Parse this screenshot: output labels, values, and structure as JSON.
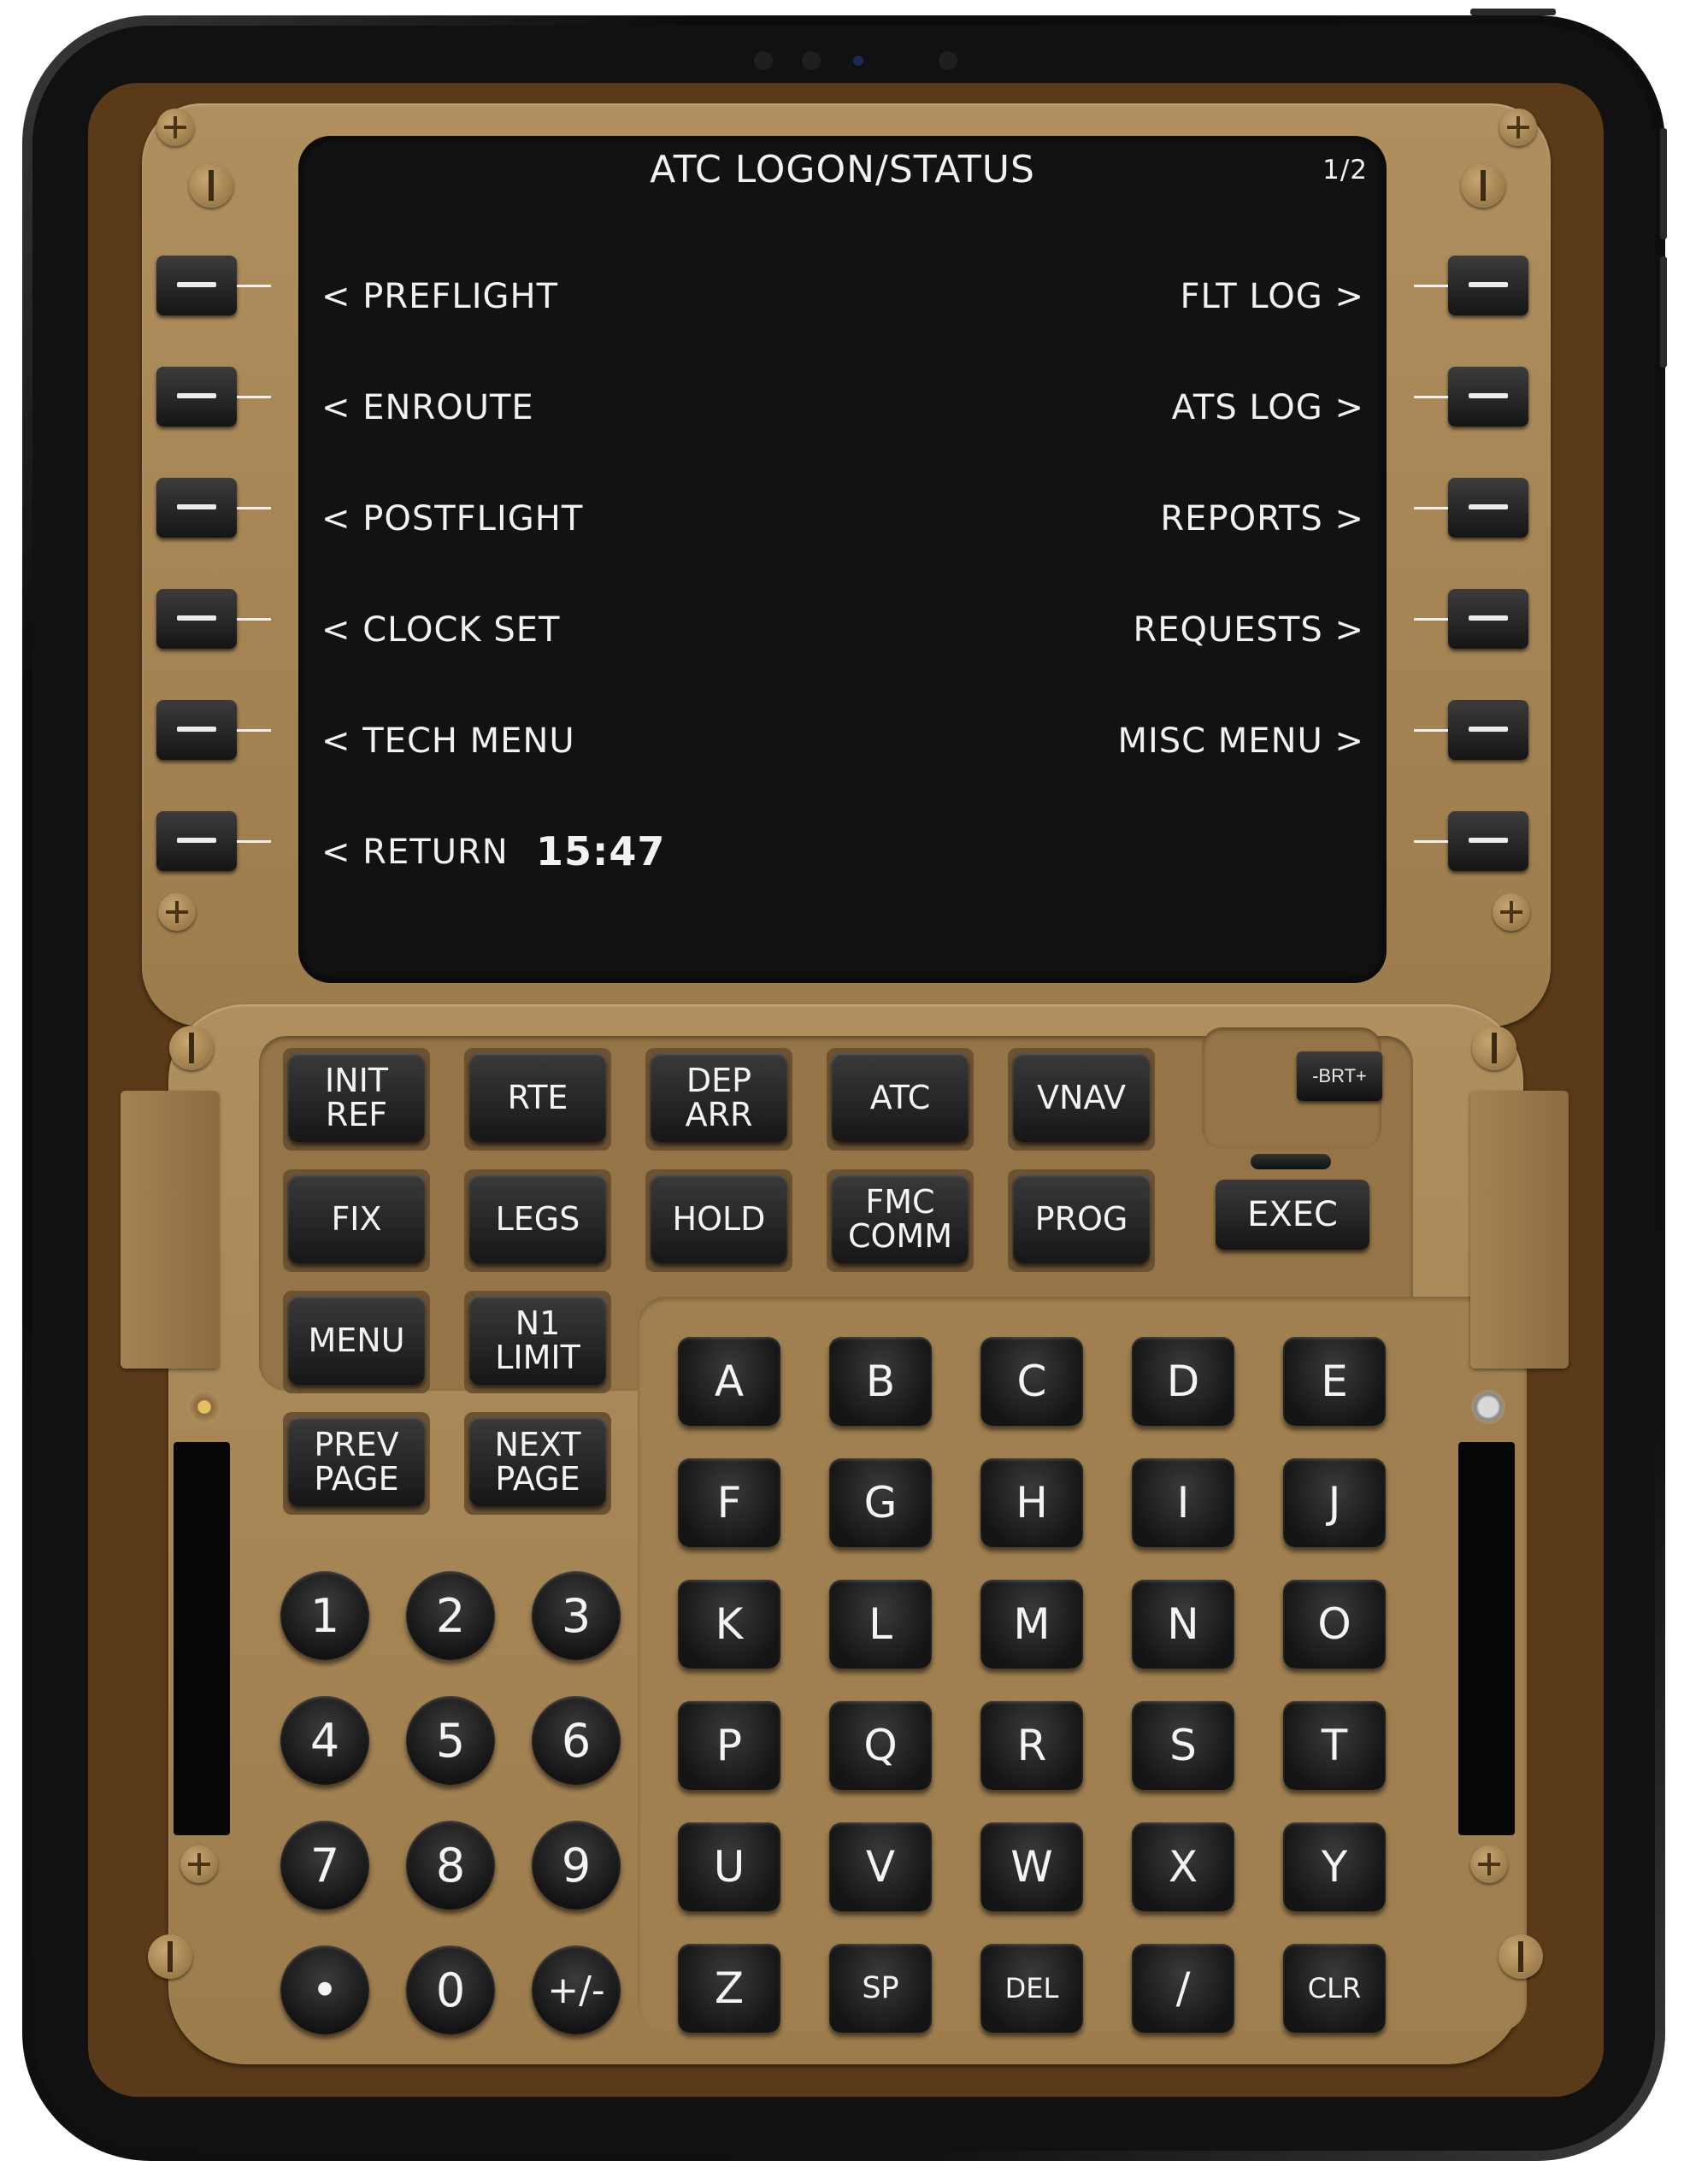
{
  "screen": {
    "title": "ATC LOGON/STATUS",
    "page": "1/2",
    "left_items": [
      "< PREFLIGHT",
      "< ENROUTE",
      "< POSTFLIGHT",
      "< CLOCK SET",
      "< TECH MENU",
      "< RETURN"
    ],
    "right_items": [
      "FLT LOG >",
      "ATS LOG >",
      "REPORTS >",
      "REQUESTS >",
      "MISC MENU >",
      ""
    ],
    "clock": "15:47"
  },
  "function_keys": {
    "init_ref": "INIT\nREF",
    "rte": "RTE",
    "dep_arr": "DEP\nARR",
    "atc": "ATC",
    "vnav": "VNAV",
    "fix": "FIX",
    "legs": "LEGS",
    "hold": "HOLD",
    "fmc_comm": "FMC\nCOMM",
    "prog": "PROG",
    "menu": "MENU",
    "n1_limit": "N1\nLIMIT",
    "prev_page": "PREV\nPAGE",
    "next_page": "NEXT\nPAGE",
    "exec": "EXEC",
    "brt": "-BRT+"
  },
  "alpha_keys": [
    "A",
    "B",
    "C",
    "D",
    "E",
    "F",
    "G",
    "H",
    "I",
    "J",
    "K",
    "L",
    "M",
    "N",
    "O",
    "P",
    "Q",
    "R",
    "S",
    "T",
    "U",
    "V",
    "W",
    "X",
    "Y",
    "Z",
    "SP",
    "DEL",
    "/",
    "CLR"
  ],
  "numeric_keys": [
    "1",
    "2",
    "3",
    "4",
    "5",
    "6",
    "7",
    "8",
    "9",
    "•",
    "0",
    "+/-"
  ],
  "colors": {
    "panel_tan": "#a8875a",
    "panel_dark": "#5a3a18",
    "screen_bg": "#121212",
    "key_black": "#1a1a1a",
    "key_text": "#f4f4f4"
  }
}
